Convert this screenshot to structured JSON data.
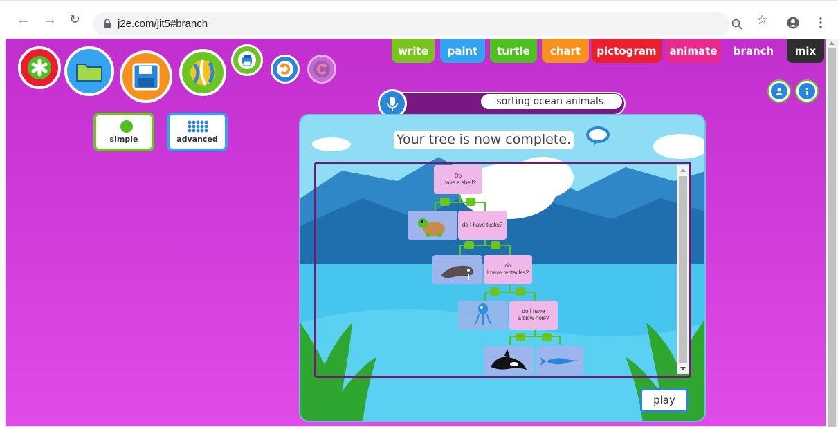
{
  "browser": {
    "url": "j2e.com/jit5#branch",
    "icons": [
      "back-arrow-icon",
      "forward-arrow-icon",
      "reload-icon",
      "lock-icon",
      "zoom-icon",
      "star-icon",
      "account-icon",
      "menu-dots-icon"
    ]
  },
  "tabs": [
    {
      "label": "write",
      "color": "#7ac41f"
    },
    {
      "label": "paint",
      "color": "#33a3ef"
    },
    {
      "label": "turtle",
      "color": "#4fbf22"
    },
    {
      "label": "chart",
      "color": "#f6911e"
    },
    {
      "label": "pictogram",
      "color": "#e9202e"
    },
    {
      "label": "animate",
      "color": "#e82c8f"
    },
    {
      "label": "branch",
      "color": "#c22fcf"
    },
    {
      "label": "mix",
      "color": "#2e2e2e"
    }
  ],
  "modes": {
    "simple": "simple",
    "advanced": "advanced"
  },
  "title_input": "sorting ocean animals.",
  "message": "Your tree is now complete.",
  "questions": {
    "q1": [
      "Do",
      "I have a shell?"
    ],
    "q2": [
      "do I have tusks?"
    ],
    "q3": [
      "do",
      "I have tentacles?"
    ],
    "q4": [
      "do I have",
      "a blow hole?"
    ]
  },
  "play_label": "play"
}
